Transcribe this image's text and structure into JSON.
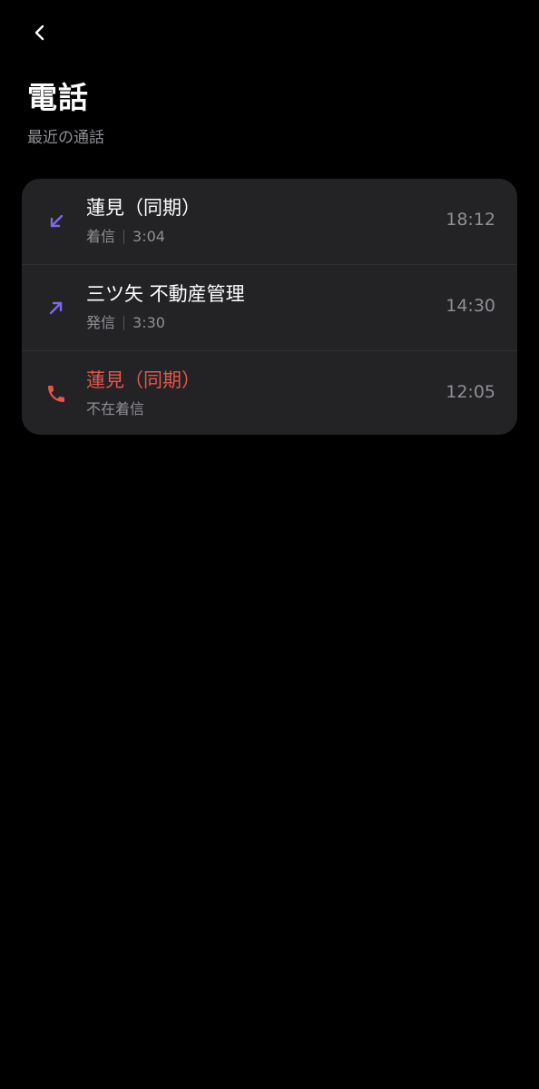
{
  "header": {
    "back_icon": "chevron-left-icon",
    "title": "電話",
    "subtitle": "最近の通話"
  },
  "colors": {
    "background": "#000000",
    "card": "#232325",
    "accent_purple": "#7b68ee",
    "missed_red": "#e8554b",
    "secondary_text": "#8f8f95"
  },
  "calls": [
    {
      "name": "蓮見（同期）",
      "type": "着信",
      "duration": "3:04",
      "time": "18:12",
      "icon": "incoming-call-arrow-icon"
    },
    {
      "name": "三ツ矢 不動産管理",
      "type": "発信",
      "duration": "3:30",
      "time": "14:30",
      "icon": "outgoing-call-arrow-icon"
    },
    {
      "name": "蓮見（同期）",
      "type": "不在着信",
      "time": "12:05",
      "icon": "missed-call-phone-icon"
    }
  ]
}
